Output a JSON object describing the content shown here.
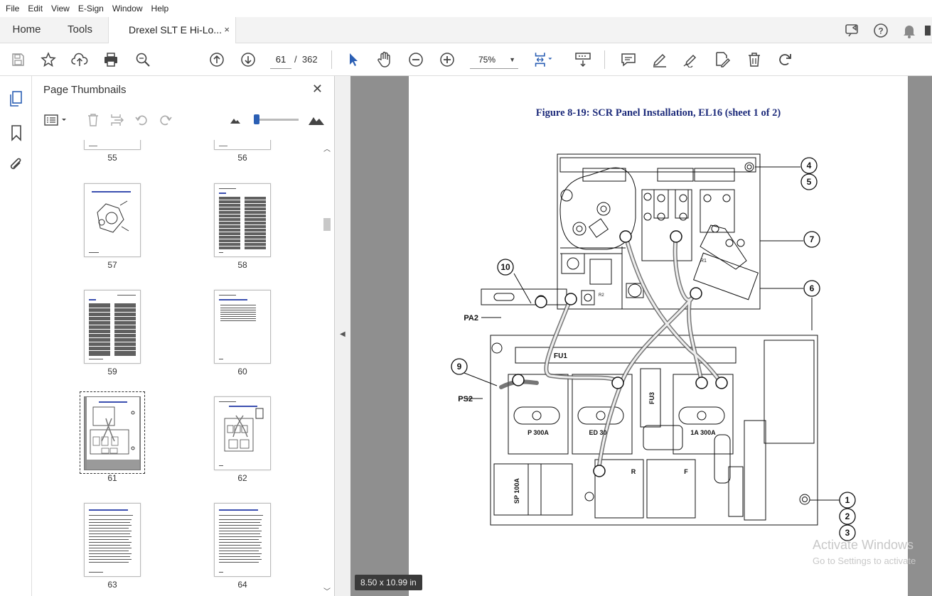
{
  "menu": [
    "File",
    "Edit",
    "View",
    "E-Sign",
    "Window",
    "Help"
  ],
  "tabs": {
    "home": "Home",
    "tools": "Tools",
    "doc": "Drexel SLT E Hi-Lo...",
    "close": "×"
  },
  "toolbar": {
    "page_current": "61",
    "page_sep": "/",
    "page_total": "362",
    "zoom": "75%"
  },
  "panel": {
    "title": "Page Thumbnails",
    "close": "✕",
    "thumbs": [
      {
        "label": "55"
      },
      {
        "label": "56"
      },
      {
        "label": "57"
      },
      {
        "label": "58"
      },
      {
        "label": "59"
      },
      {
        "label": "60"
      },
      {
        "label": "61",
        "selected": true
      },
      {
        "label": "62"
      },
      {
        "label": "63"
      },
      {
        "label": "64"
      }
    ]
  },
  "document": {
    "figure_title": "Figure 8-19:  SCR Panel Installation, EL16 (sheet 1 of 2)",
    "callouts": [
      "1",
      "2",
      "3",
      "4",
      "5",
      "6",
      "7",
      "9",
      "10"
    ],
    "labels": {
      "pa2": "PA2",
      "ps2": "PS2",
      "fu1": "FU1",
      "fu3": "FU3",
      "p300": "P 300A",
      "ed30": "ED 30",
      "a300": "1A 300A",
      "sp100": "SP 100A",
      "r": "R",
      "f": "F",
      "r1": "R1",
      "r2": "R2"
    },
    "page_size": "8.50 x 10.99 in"
  },
  "watermark": {
    "line1": "Activate Windows",
    "line2": "Go to Settings to activate"
  },
  "colors": {
    "accent": "#2b5fb4",
    "title_blue": "#1c2a7a",
    "doc_bg": "#8f8f8f"
  }
}
